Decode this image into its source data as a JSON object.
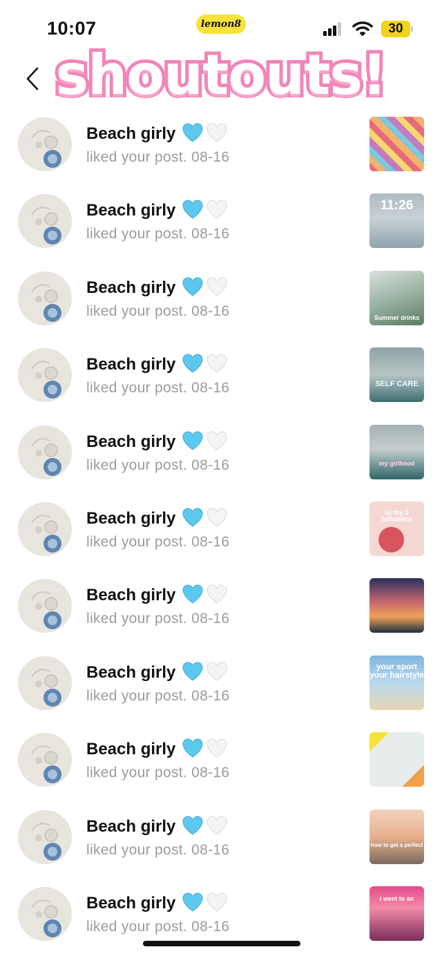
{
  "status_bar": {
    "time": "10:07",
    "app_badge": "lemon8",
    "battery": "30"
  },
  "header": {
    "banner": "shoutouts!"
  },
  "notifications": [
    {
      "user": "Beach girly",
      "activity": "liked your post. 08-16",
      "thumb_caption": ""
    },
    {
      "user": "Beach girly",
      "activity": "liked your post. 08-16",
      "thumb_caption": "11:26"
    },
    {
      "user": "Beach girly",
      "activity": "liked your post. 08-16",
      "thumb_caption": "Summer drinks"
    },
    {
      "user": "Beach girly",
      "activity": "liked your post. 08-16",
      "thumb_caption": "SELF CARE"
    },
    {
      "user": "Beach girly",
      "activity": "liked your post. 08-16",
      "thumb_caption": "my girlhood"
    },
    {
      "user": "Beach girly",
      "activity": "liked your post. 08-16",
      "thumb_caption": "to my 1 followers"
    },
    {
      "user": "Beach girly",
      "activity": "liked your post. 08-16",
      "thumb_caption": ""
    },
    {
      "user": "Beach girly",
      "activity": "liked your post. 08-16",
      "thumb_caption": "your sport your hairstyle"
    },
    {
      "user": "Beach girly",
      "activity": "liked your post. 08-16",
      "thumb_caption": ""
    },
    {
      "user": "Beach girly",
      "activity": "liked your post. 08-16",
      "thumb_caption": "how to get a perfect"
    },
    {
      "user": "Beach girly",
      "activity": "liked your post. 08-16",
      "thumb_caption": "i went to an"
    }
  ],
  "colors": {
    "banner_pink": "#f285b9",
    "heart_blue": "#5cc8ee",
    "status_yellow": "#f7e23a"
  },
  "icons": {
    "back": "chevron-left-icon",
    "heart_blue": "blue-heart-icon",
    "heart_white": "white-heart-icon"
  }
}
